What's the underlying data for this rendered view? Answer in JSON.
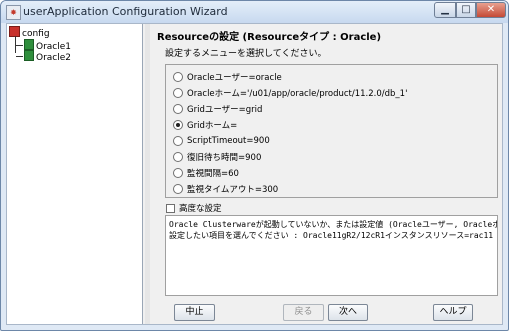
{
  "window": {
    "title": "userApplication Configuration Wizard"
  },
  "tree": {
    "root": "config",
    "children": [
      "Oracle1",
      "Oracle2"
    ]
  },
  "main": {
    "section_title": "Resourceの設定 (Resourceタイプ : Oracle)",
    "description": "設定するメニューを選択してください。",
    "options": [
      {
        "label": "Oracleユーザー=oracle",
        "selected": false
      },
      {
        "label": "Oracleホーム='/u01/app/oracle/product/11.2.0/db_1'",
        "selected": false
      },
      {
        "label": "Gridユーザー=grid",
        "selected": false
      },
      {
        "label": "Gridホーム=",
        "selected": true
      },
      {
        "label": "ScriptTimeout=900",
        "selected": false
      },
      {
        "label": "復旧待ち時間=900",
        "selected": false
      },
      {
        "label": "監視間隔=60",
        "selected": false
      },
      {
        "label": "監視タイムアウト=300",
        "selected": false
      }
    ],
    "advanced_label": "高度な設定",
    "messages": [
      "Oracle Clusterwareが起動していないか、または設定値 (Oracleユーザー, Oracleホーム",
      "設定したい項目を選んでください : Oracle11gR2/12cR1インスタンスリソース=rac11"
    ]
  },
  "buttons": {
    "cancel": "中止",
    "back": "戻る",
    "next": "次へ",
    "help": "ヘルプ"
  }
}
